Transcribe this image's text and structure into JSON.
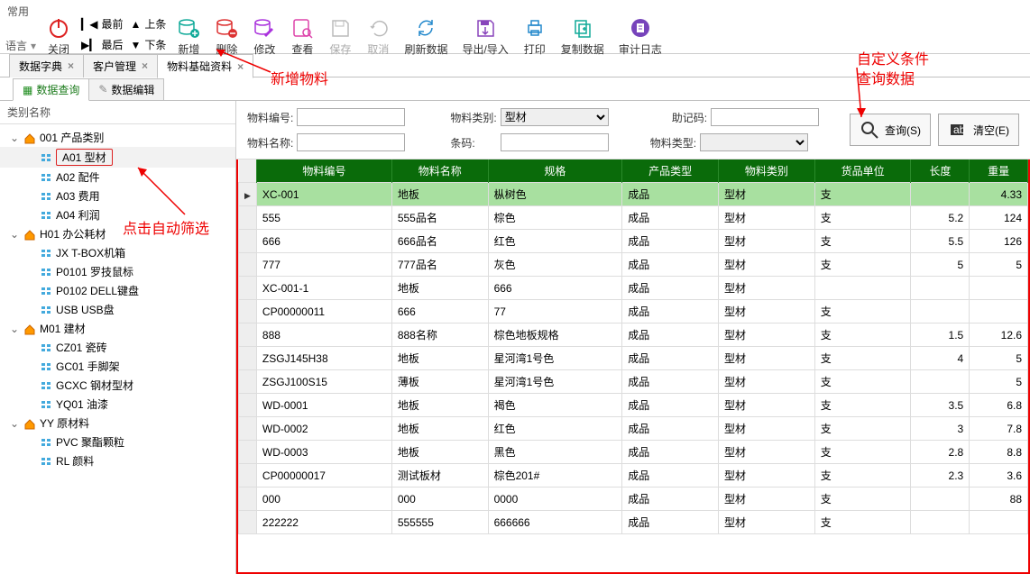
{
  "topbar": {
    "common": "常用",
    "lang": "语言",
    "close": "关闭",
    "first": "最前",
    "prev": "上条",
    "last": "最后",
    "next": "下条",
    "add": "新增",
    "del": "删除",
    "edit": "修改",
    "view": "查看",
    "save": "保存",
    "cancel": "取消",
    "refresh": "刷新数据",
    "export": "导出/导入",
    "print": "打印",
    "copy": "复制数据",
    "audit": "审计日志"
  },
  "tabs": {
    "t1": "数据字典",
    "t2": "客户管理",
    "t3": "物料基础资料"
  },
  "subtabs": {
    "s1": "数据查询",
    "s2": "数据编辑"
  },
  "tree": {
    "head": "类别名称",
    "n001": "001 产品类别",
    "a01": "A01 型材",
    "a02": "A02 配件",
    "a03": "A03 费用",
    "a04": "A04 利润",
    "h01": "H01 办公耗材",
    "jx": "JX T-BOX机箱",
    "p0101": "P0101 罗技鼠标",
    "p0102": "P0102 DELL键盘",
    "usb": "USB USB盘",
    "m01": "M01 建材",
    "cz01": "CZ01 瓷砖",
    "gc01": "GC01 手脚架",
    "gcxc": "GCXC 钢材型材",
    "yq01": "YQ01 油漆",
    "yy": "YY 原材料",
    "pvc": "PVC 聚酯颗粒",
    "rl": "RL 颜料"
  },
  "filter": {
    "code_l": "物料编号:",
    "name_l": "物料名称:",
    "cat_l": "物料类别:",
    "cat_v": "型材",
    "barcode_l": "条码:",
    "mnemo_l": "助记码:",
    "type_l": "物料类型:",
    "query": "查询(S)",
    "clear": "清空(E)"
  },
  "cols": {
    "c1": "物料编号",
    "c2": "物料名称",
    "c3": "规格",
    "c4": "产品类型",
    "c5": "物料类别",
    "c6": "货品单位",
    "c7": "长度",
    "c8": "重量"
  },
  "rows": [
    {
      "c1": "XC-001",
      "c2": "地板",
      "c3": "枞树色",
      "c4": "成品",
      "c5": "型材",
      "c6": "支",
      "c7": "",
      "c8": "4.33",
      "hl": true,
      "arrow": true
    },
    {
      "c1": "555",
      "c2": "555品名",
      "c3": "棕色",
      "c4": "成品",
      "c5": "型材",
      "c6": "支",
      "c7": "5.2",
      "c8": "124"
    },
    {
      "c1": "666",
      "c2": "666品名",
      "c3": "红色",
      "c4": "成品",
      "c5": "型材",
      "c6": "支",
      "c7": "5.5",
      "c8": "126"
    },
    {
      "c1": "777",
      "c2": "777品名",
      "c3": "灰色",
      "c4": "成品",
      "c5": "型材",
      "c6": "支",
      "c7": "5",
      "c8": "5"
    },
    {
      "c1": "XC-001-1",
      "c2": "地板",
      "c3": "666",
      "c4": "成品",
      "c5": "型材",
      "c6": "",
      "c7": "",
      "c8": ""
    },
    {
      "c1": "CP00000011",
      "c2": "666",
      "c3": "77",
      "c4": "成品",
      "c5": "型材",
      "c6": "支",
      "c7": "",
      "c8": ""
    },
    {
      "c1": "888",
      "c2": "888名称",
      "c3": "棕色地板规格",
      "c4": "成品",
      "c5": "型材",
      "c6": "支",
      "c7": "1.5",
      "c8": "12.6"
    },
    {
      "c1": "ZSGJ145H38",
      "c2": "地板",
      "c3": "星河湾1号色",
      "c4": "成品",
      "c5": "型材",
      "c6": "支",
      "c7": "4",
      "c8": "5"
    },
    {
      "c1": "ZSGJ100S15",
      "c2": "薄板",
      "c3": "星河湾1号色",
      "c4": "成品",
      "c5": "型材",
      "c6": "支",
      "c7": "",
      "c8": "5"
    },
    {
      "c1": "WD-0001",
      "c2": "地板",
      "c3": "褐色",
      "c4": "成品",
      "c5": "型材",
      "c6": "支",
      "c7": "3.5",
      "c8": "6.8"
    },
    {
      "c1": "WD-0002",
      "c2": "地板",
      "c3": "红色",
      "c4": "成品",
      "c5": "型材",
      "c6": "支",
      "c7": "3",
      "c8": "7.8"
    },
    {
      "c1": "WD-0003",
      "c2": "地板",
      "c3": "黑色",
      "c4": "成品",
      "c5": "型材",
      "c6": "支",
      "c7": "2.8",
      "c8": "8.8"
    },
    {
      "c1": "CP00000017",
      "c2": "测试板材",
      "c3": "棕色201#",
      "c4": "成品",
      "c5": "型材",
      "c6": "支",
      "c7": "2.3",
      "c8": "3.6"
    },
    {
      "c1": "000",
      "c2": "000",
      "c3": "0000",
      "c4": "成品",
      "c5": "型材",
      "c6": "支",
      "c7": "",
      "c8": "88"
    },
    {
      "c1": "222222",
      "c2": "555555",
      "c3": "666666",
      "c4": "成品",
      "c5": "型材",
      "c6": "支",
      "c7": "",
      "c8": ""
    }
  ],
  "anno": {
    "addmat": "新增物料",
    "autofilter": "点击自动筛选",
    "custom1": "自定义条件",
    "custom2": "查询数据"
  }
}
